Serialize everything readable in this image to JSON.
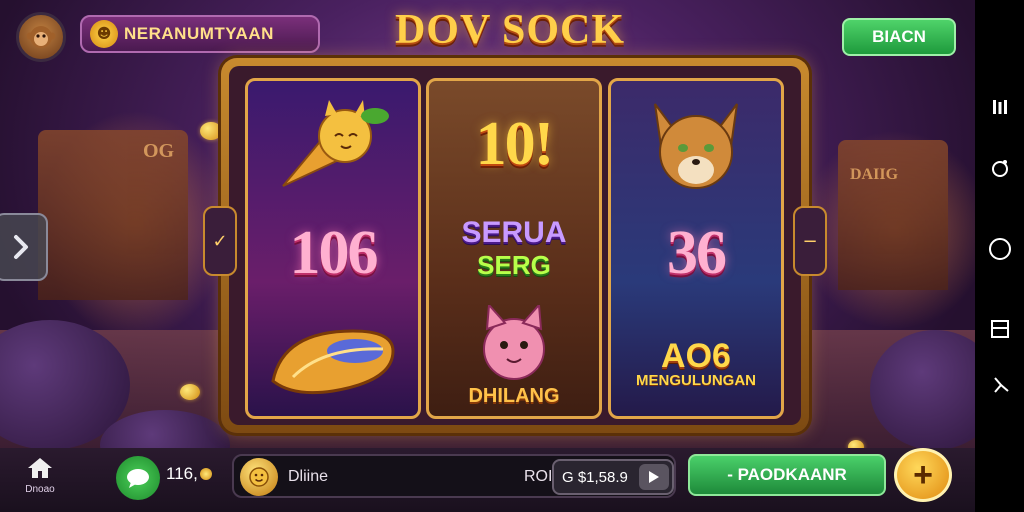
{
  "header": {
    "player_name": "NERANUMTYAAN",
    "game_title": "DOV SOCK",
    "top_button_label": "BIACN"
  },
  "reels": {
    "reel1": {
      "middle_number": "106"
    },
    "reel2": {
      "top_number": "10!",
      "middle_word_1": "SERUA",
      "middle_word_2": "SERG",
      "bottom_word": "DHILANG"
    },
    "reel3": {
      "middle_number": "36",
      "bottom_code": "AO6",
      "bottom_word": "MENGULUNGAN"
    }
  },
  "scene": {
    "left_sign": "OG",
    "right_sign": "DAIIG"
  },
  "bottom_bar": {
    "home_label": "Dnoao",
    "credits": "116,",
    "bet_label": "Dliine",
    "bet_prefix": "ROI",
    "bet_value": "G $1,58.9",
    "spin_label": "- PAODKAANR",
    "plus_label": "+"
  },
  "colors": {
    "accent_gold": "#ffcf4a",
    "button_green": "#1e9a3c",
    "frame_gold": "#c88a2e"
  }
}
